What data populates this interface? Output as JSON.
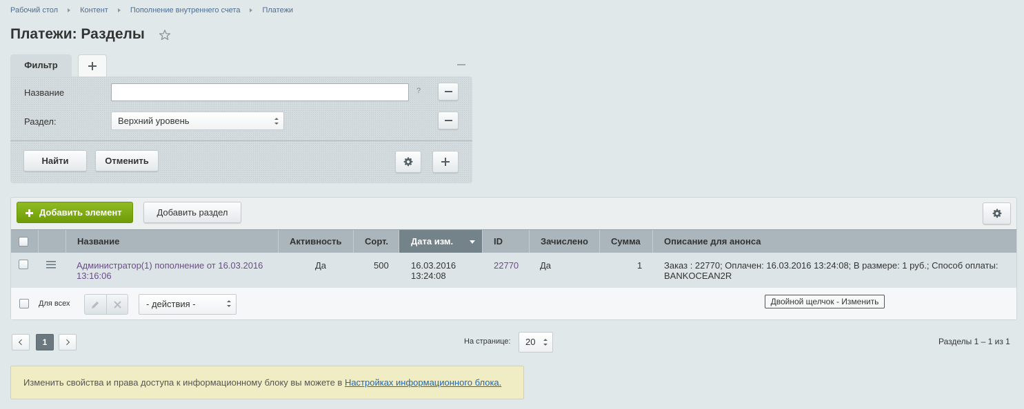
{
  "breadcrumbs": [
    "Рабочий стол",
    "Контент",
    "Пополнение внутреннего счета",
    "Платежи"
  ],
  "page_title": "Платежи: Разделы",
  "filter": {
    "tab_label": "Фильтр",
    "fields": [
      {
        "label": "Название",
        "value": "",
        "help": "?"
      },
      {
        "label": "Раздел:",
        "value": "Верхний уровень"
      }
    ],
    "find_label": "Найти",
    "cancel_label": "Отменить"
  },
  "toolbar": {
    "add_element_label": "Добавить элемент",
    "add_section_label": "Добавить раздел"
  },
  "table": {
    "columns": [
      "Название",
      "Активность",
      "Сорт.",
      "Дата изм.",
      "ID",
      "Зачислено",
      "Сумма",
      "Описание для анонса"
    ],
    "sorted_column": "Дата изм.",
    "rows": [
      {
        "name": "Администратор(1) пополнение от 16.03.2016 13:16:06",
        "active": "Да",
        "sort": "500",
        "date": "16.03.2016 13:24:08",
        "id": "22770",
        "credited": "Да",
        "sum": "1",
        "description": "Заказ : 22770; Оплачен: 16.03.2016 13:24:08; В размере: 1 руб.; Способ оплаты: BANKOCEAN2R"
      }
    ],
    "for_all_label": "Для всех",
    "actions_select": "- действия -",
    "dblclick_hint": "Двойной щелчок - Изменить"
  },
  "pagination": {
    "current_page": "1",
    "per_page_label": "На странице:",
    "per_page_value": "20",
    "summary": "Разделы 1 – 1 из 1"
  },
  "info": {
    "text": "Изменить свойства и права доступа к информационному блоку вы можете в ",
    "link_text": "Настройках информационного блока."
  }
}
